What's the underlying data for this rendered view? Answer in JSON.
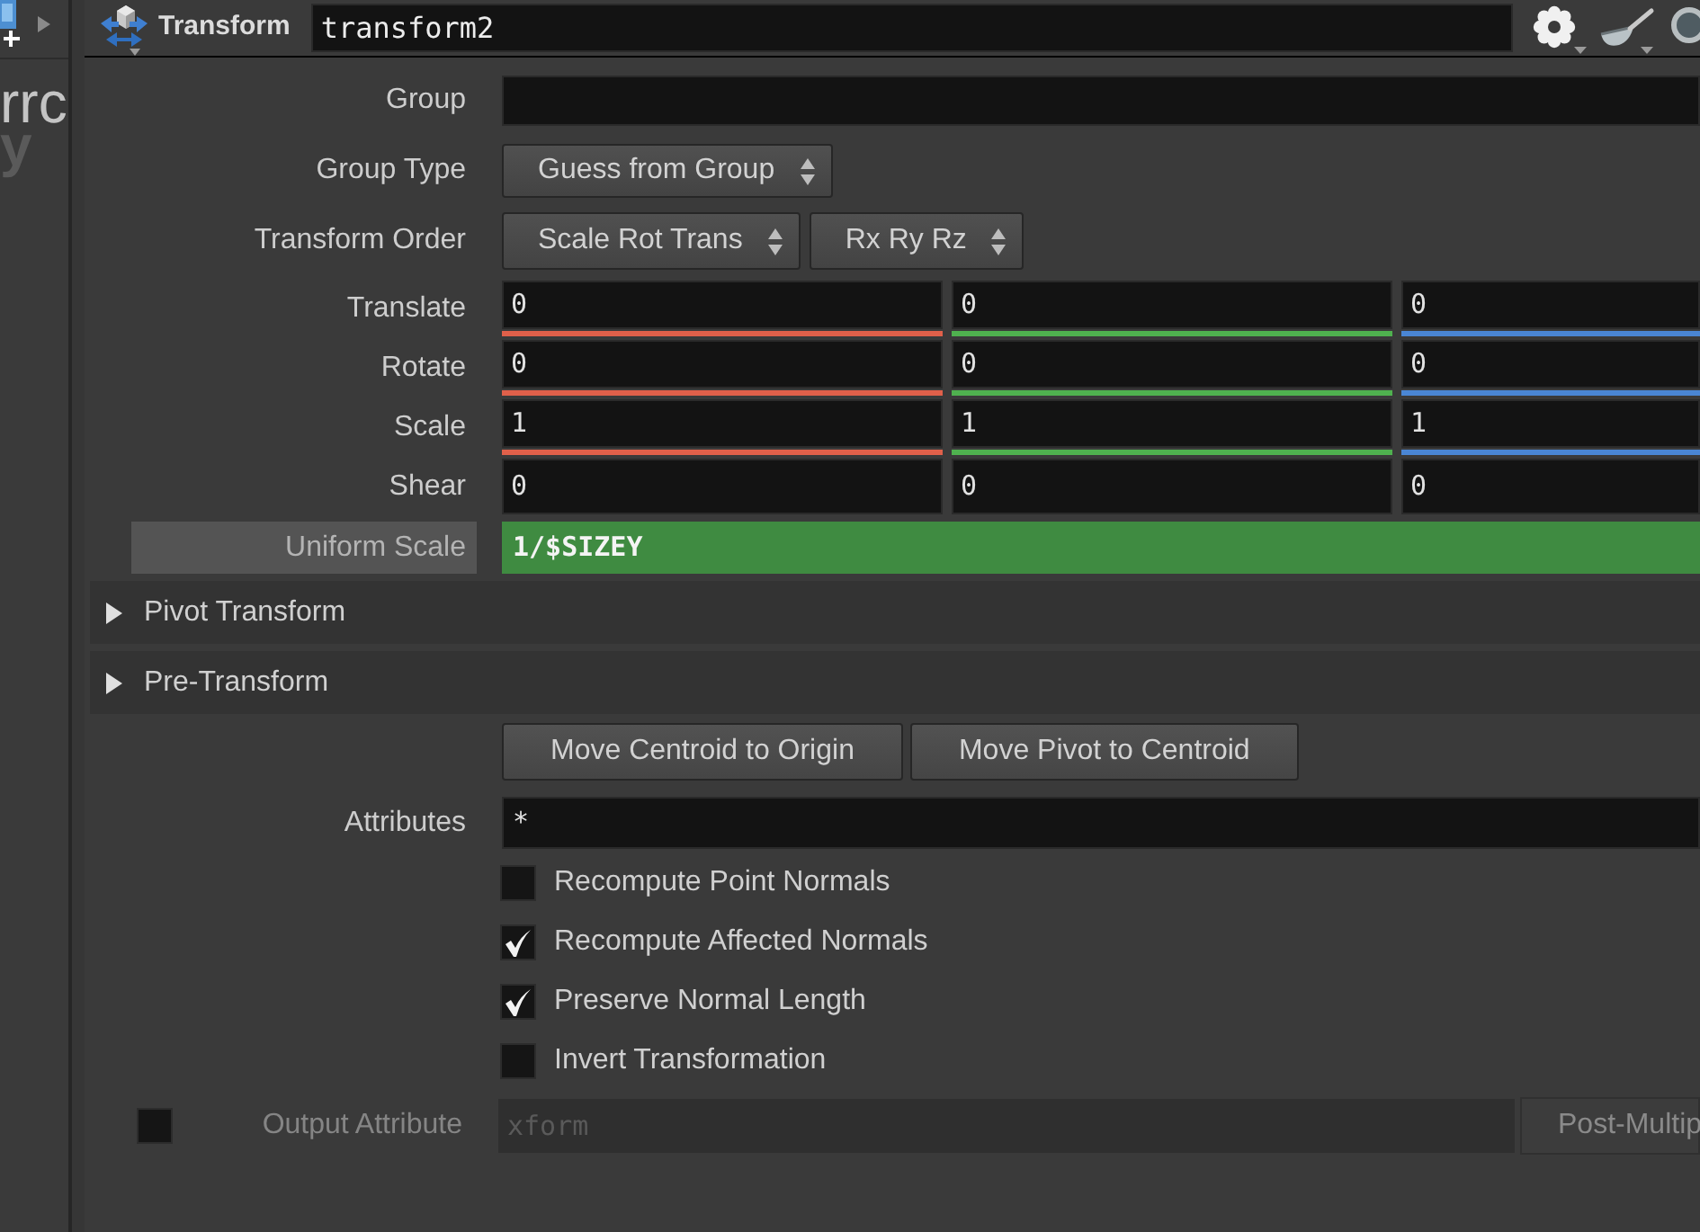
{
  "network_view": {
    "label_1": "rrc",
    "label_2": "y"
  },
  "header": {
    "node_type": "Transform",
    "node_name": "transform2"
  },
  "parameters": [
    {
      "kind": "text",
      "label": "Group",
      "highlighted": false
    },
    {
      "kind": "menu",
      "label": "Group Type",
      "menus": [
        "Guess from Group"
      ],
      "highlighted": false
    },
    {
      "kind": "menu",
      "label": "Transform Order",
      "menus": [
        "Scale Rot Trans",
        "Rx Ry Rz"
      ],
      "highlighted": false
    },
    {
      "kind": "vector",
      "label": "Translate",
      "components": [
        {
          "value": "0",
          "color": "#e0604a"
        },
        {
          "value": "0",
          "color": "#4fb14f"
        },
        {
          "value": "0",
          "color": "#4a86d4"
        }
      ],
      "highlighted": false
    },
    {
      "kind": "vector",
      "label": "Rotate",
      "components": [
        {
          "value": "0",
          "color": "#e0604a"
        },
        {
          "value": "0",
          "color": "#4fb14f"
        },
        {
          "value": "0",
          "color": "#4a86d4"
        }
      ],
      "highlighted": false
    },
    {
      "kind": "vector",
      "label": "Scale",
      "components": [
        {
          "value": "1",
          "color": "#e0604a"
        },
        {
          "value": "1",
          "color": "#4fb14f"
        },
        {
          "value": "1",
          "color": "#4a86d4"
        }
      ],
      "highlighted": false
    },
    {
      "kind": "vector",
      "label": "Shear",
      "components": [
        {
          "value": "0"
        },
        {
          "value": "0"
        },
        {
          "value": "0"
        }
      ],
      "highlighted": false
    },
    {
      "kind": "expression",
      "label": "Uniform Scale",
      "value": "1/$SIZEY",
      "highlighted": true
    }
  ],
  "folders": [
    {
      "label": "Pivot Transform",
      "expanded": false
    },
    {
      "label": "Pre-Transform",
      "expanded": false
    }
  ],
  "action_buttons": [
    "Move Centroid to Origin",
    "Move Pivot to Centroid"
  ],
  "attributes": {
    "label": "Attributes",
    "value": "*"
  },
  "toggles": [
    {
      "label": "Recompute Point Normals",
      "checked": false
    },
    {
      "label": "Recompute Affected Normals",
      "checked": true
    },
    {
      "label": "Preserve Normal Length",
      "checked": true
    },
    {
      "label": "Invert Transformation",
      "checked": false
    }
  ],
  "output_attribute": {
    "checked": false,
    "disabled": true,
    "label": "Output Attribute",
    "value": "xform",
    "menu": "Post-Multip"
  }
}
